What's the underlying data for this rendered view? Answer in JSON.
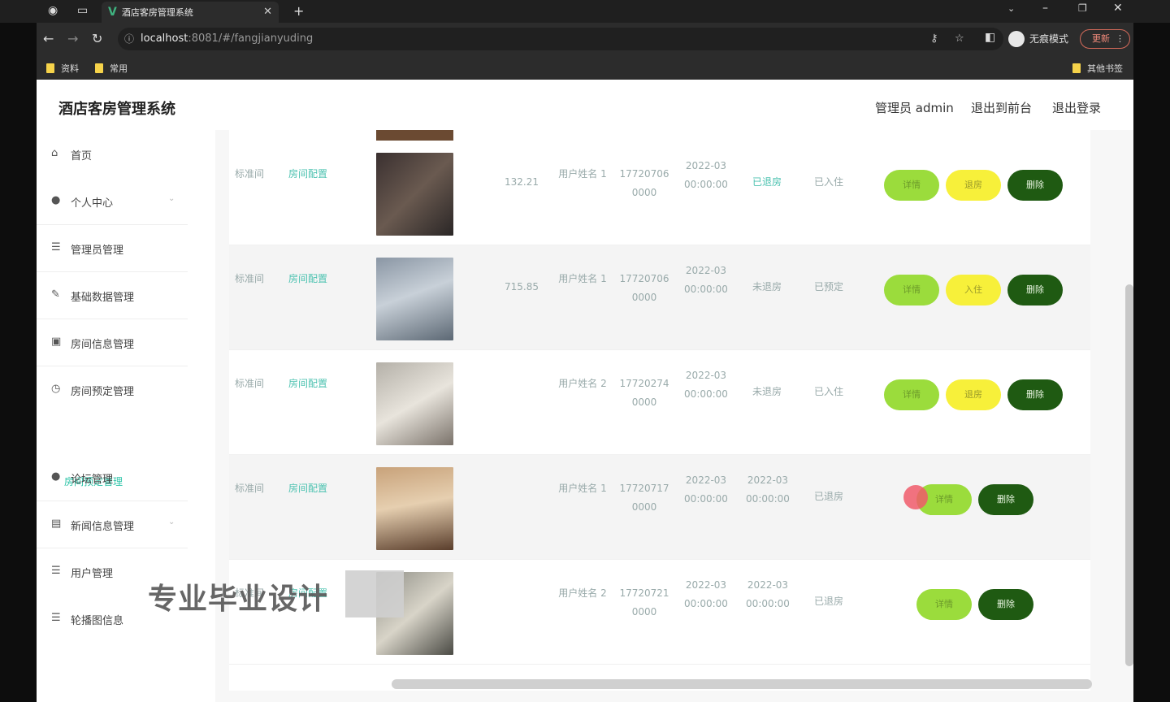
{
  "browser": {
    "tab_title": "酒店客房管理系统",
    "url_host": "localhost",
    "url_path": ":8081/#/fangjianyuding",
    "incognito_label": "无痕模式",
    "update_label": "更新",
    "bookmarks": [
      "资料",
      "常用"
    ],
    "other_bookmarks": "其他书签"
  },
  "header": {
    "brand": "酒店客房管理系统",
    "admin_label": "管理员 admin",
    "front_link": "退出到前台",
    "logout_link": "退出登录"
  },
  "sidebar": {
    "items": [
      {
        "label": "首页",
        "icon": "home-icon"
      },
      {
        "label": "个人中心",
        "icon": "user-icon"
      },
      {
        "label": "管理员管理",
        "icon": "list-icon"
      },
      {
        "label": "基础数据管理",
        "icon": "tool-icon"
      },
      {
        "label": "房间信息管理",
        "icon": "clipboard-icon"
      },
      {
        "label": "房间预定管理",
        "icon": "clock-icon"
      },
      {
        "label": "论坛管理",
        "icon": "user-icon"
      },
      {
        "label": "新闻信息管理",
        "icon": "news-icon"
      },
      {
        "label": "用户管理",
        "icon": "list-icon"
      },
      {
        "label": "轮播图信息",
        "icon": "list-icon"
      }
    ],
    "sub_item": "房间预定管理"
  },
  "table": {
    "rows": [
      {
        "c1": "标准间",
        "c2": "房间配置",
        "price": "132.21",
        "user": "用户姓名 1",
        "phone": "17720706 0000",
        "date1": "2022-03 00:00:00",
        "date2": "",
        "status1": "已退房",
        "status2": "已入住",
        "btn2": "退房",
        "show_edit": true
      },
      {
        "c1": "标准间",
        "c2": "房间配置",
        "price": "715.85",
        "user": "用户姓名 1",
        "phone": "17720706 0000",
        "date1": "2022-03 00:00:00",
        "date2": "",
        "status1": "未退房",
        "status2": "已预定",
        "btn2": "入住",
        "show_edit": true
      },
      {
        "c1": "标准间",
        "c2": "房间配置",
        "price": "",
        "user": "用户姓名 2",
        "phone": "17720274 0000",
        "date1": "2022-03 00:00:00",
        "date2": "",
        "status1": "未退房",
        "status2": "已入住",
        "btn2": "退房",
        "show_edit": true
      },
      {
        "c1": "标准间",
        "c2": "房间配置",
        "price": "",
        "user": "用户姓名 1",
        "phone": "17720717 0000",
        "date1": "2022-03 00:00:00",
        "date2": "2022-03 00:00:00",
        "status1": "已退房",
        "status2": "",
        "btn2": "",
        "show_edit": false
      },
      {
        "c1": "标准间",
        "c2": "房间配置",
        "price": "",
        "user": "用户姓名 2",
        "phone": "17720721 0000",
        "date1": "2022-03 00:00:00",
        "date2": "2022-03 00:00:00",
        "status1": "已退房",
        "status2": "",
        "btn2": "",
        "show_edit": false
      }
    ],
    "edit_label": "详情",
    "delete_label": "删除"
  },
  "watermark": "专业毕业设计",
  "colors": {
    "teal": "#2ec4a8",
    "green": "#9bdc3c",
    "yellow": "#f7f03a",
    "darkgreen": "#1f5a12"
  }
}
